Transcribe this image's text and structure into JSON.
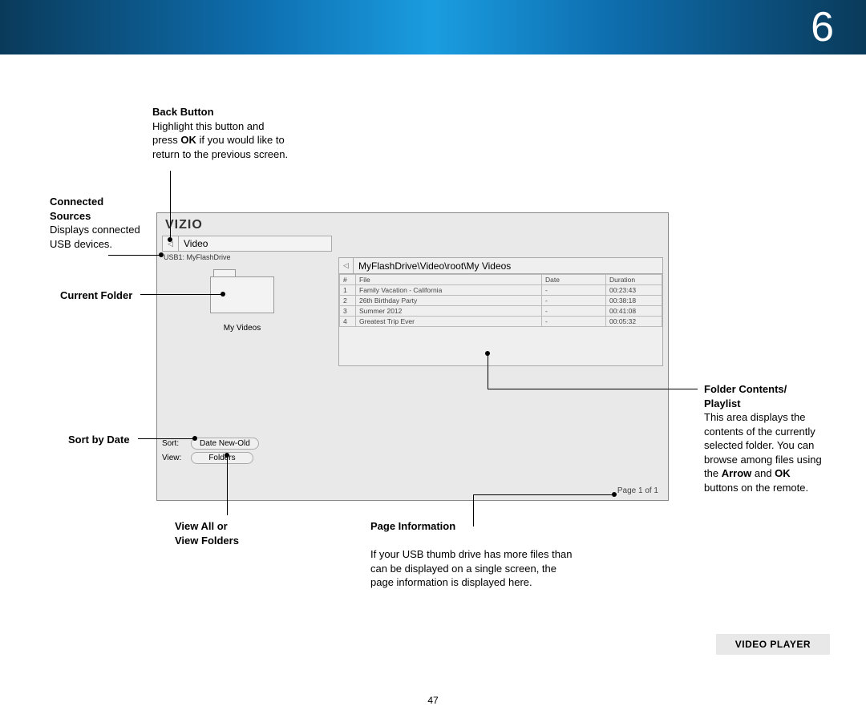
{
  "chapter_number": "6",
  "page_number": "47",
  "page_caption": "VIDEO PLAYER",
  "callouts": {
    "back_button": {
      "title": "Back Button",
      "body_before_ok": "Highlight this button and press ",
      "ok": "OK",
      "body_after_ok": " if you would like to return to the previous screen."
    },
    "connected_sources": {
      "title": "Connected Sources",
      "body": "Displays connected USB devices."
    },
    "current_folder": {
      "title": "Current Folder"
    },
    "sort_by_date": {
      "title": "Sort by Date"
    },
    "view_all": {
      "line1": "View All or",
      "line2": "View Folders"
    },
    "page_info": {
      "title": "Page Information",
      "body": "If your USB thumb drive has more files than can be displayed on a single screen, the page information is displayed here."
    },
    "folder_contents": {
      "title": "Folder Contents/ Playlist",
      "p1a": "This area displays the contents of the currently selected folder. You can browse among files using the ",
      "arrow": "Arrow",
      "p1b": " and ",
      "ok": "OK",
      "p1c": " buttons on the remote."
    }
  },
  "screenshot": {
    "logo": "VIZIO",
    "sidebar": {
      "video_label": "Video",
      "usb_label": "USB1: MyFlashDrive",
      "folder_name": "My Videos",
      "sort_key": "Sort:",
      "sort_val": "Date New-Old",
      "view_key": "View:",
      "view_val": "Folders"
    },
    "main": {
      "breadcrumb": "MyFlashDrive\\Video\\root\\My Videos",
      "headers": {
        "num": "#",
        "file": "File",
        "date": "Date",
        "duration": "Duration"
      },
      "rows": [
        {
          "n": "1",
          "file": "Family Vacation - California",
          "date": "-",
          "duration": "00:23:43"
        },
        {
          "n": "2",
          "file": "26th Birthday Party",
          "date": "-",
          "duration": "00:38:18"
        },
        {
          "n": "3",
          "file": "Summer 2012",
          "date": "-",
          "duration": "00:41:08"
        },
        {
          "n": "4",
          "file": "Greatest Trip Ever",
          "date": "-",
          "duration": "00:05:32"
        }
      ],
      "page_info": "Page 1 of 1"
    }
  }
}
